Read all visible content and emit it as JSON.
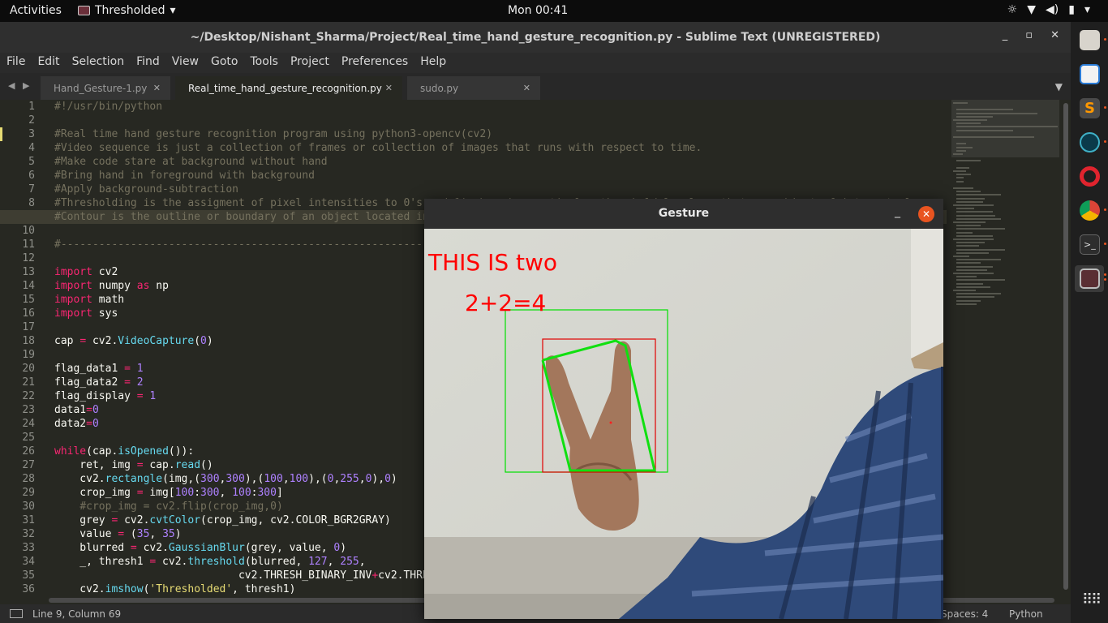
{
  "topbar": {
    "activities": "Activities",
    "app_name": "Thresholded",
    "clock": "Mon 00:41",
    "tray_icons": [
      "brightness-icon",
      "wifi-icon",
      "volume-icon",
      "battery-icon",
      "chevron-down-icon"
    ]
  },
  "window": {
    "title": "~/Desktop/Nishant_Sharma/Project/Real_time_hand_gesture_recognition.py - Sublime Text (UNREGISTERED)"
  },
  "menu": [
    "File",
    "Edit",
    "Selection",
    "Find",
    "View",
    "Goto",
    "Tools",
    "Project",
    "Preferences",
    "Help"
  ],
  "tabs": [
    {
      "label": "Hand_Gesture-1.py"
    },
    {
      "label": "Real_time_hand_gesture_recognition.py"
    },
    {
      "label": "sudo.py"
    }
  ],
  "editor": {
    "line_numbers": [
      "1",
      "2",
      "3",
      "4",
      "5",
      "6",
      "7",
      "8",
      "9",
      "10",
      "11",
      "12",
      "13",
      "14",
      "15",
      "16",
      "17",
      "18",
      "19",
      "20",
      "21",
      "22",
      "23",
      "24",
      "25",
      "26",
      "27",
      "28",
      "29",
      "30",
      "31",
      "32",
      "33",
      "34",
      "35",
      "36"
    ],
    "current_line": 9
  },
  "status": {
    "position": "Line 9, Column 69",
    "spaces": "Spaces: 4",
    "syntax": "Python"
  },
  "gesture_window": {
    "title": "Gesture",
    "overlay_line1": "THIS IS two",
    "overlay_line2": "2+2=4",
    "overlay_color": "#ff0000"
  },
  "colors": {
    "accent": "#e95420",
    "comment": "#75715e",
    "keyword": "#f92672",
    "number": "#ae81ff",
    "function": "#66d9ef",
    "string": "#e6db74"
  }
}
